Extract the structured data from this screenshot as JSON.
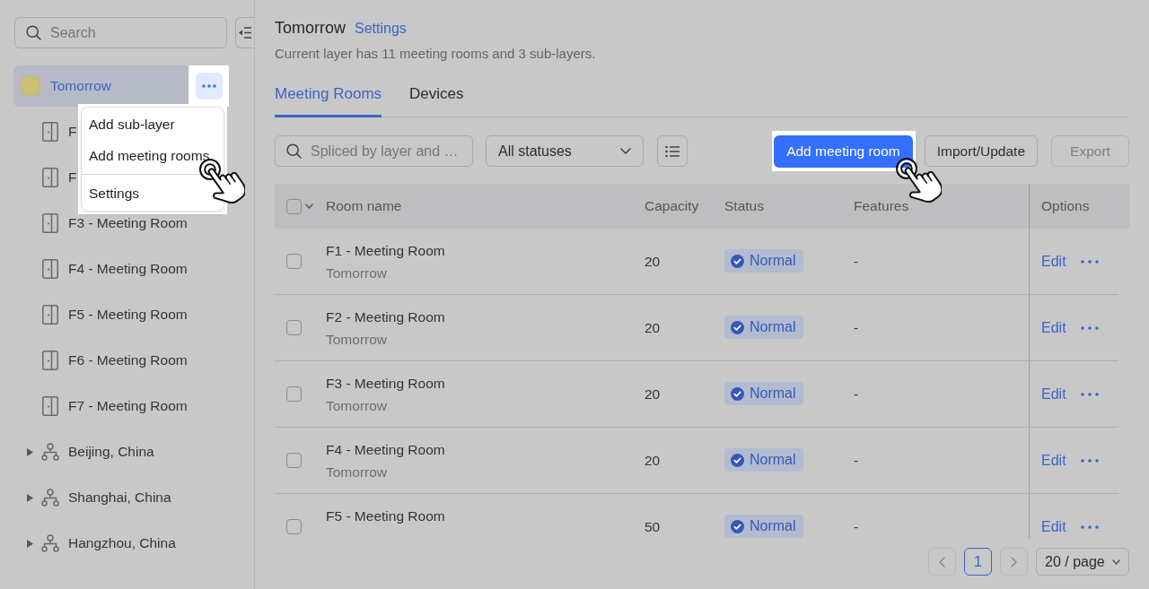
{
  "sidebar": {
    "search": {
      "placeholder": "Search"
    },
    "tree": [
      {
        "kind": "root",
        "label": "Tomorrow",
        "selected": true,
        "more_button": {
          "spotlight": true
        },
        "children": [
          {
            "kind": "room",
            "label": "F",
            "selected": false
          },
          {
            "kind": "room",
            "label": "F",
            "selected": false
          },
          {
            "kind": "room",
            "label": "F3 - Meeting Room",
            "selected": false
          },
          {
            "kind": "room",
            "label": "F4 - Meeting Room",
            "selected": false
          },
          {
            "kind": "room",
            "label": "F5 - Meeting Room",
            "selected": false
          },
          {
            "kind": "room",
            "label": "F6 - Meeting Room",
            "selected": false
          },
          {
            "kind": "room",
            "label": "F7 - Meeting Room",
            "selected": false
          }
        ]
      },
      {
        "kind": "layer",
        "label": "Beijing, China",
        "selected": false,
        "expanded": false
      },
      {
        "kind": "layer",
        "label": "Shanghai, China",
        "selected": false,
        "expanded": false
      },
      {
        "kind": "layer",
        "label": "Hangzhou, China",
        "selected": false,
        "expanded": false
      }
    ]
  },
  "context_menu": {
    "spotlight": true,
    "sections": [
      [
        {
          "label": "Add sub-layer",
          "cursor": false
        },
        {
          "label": "Add meeting rooms",
          "cursor": true
        }
      ],
      [
        {
          "label": "Settings",
          "cursor": false
        }
      ]
    ]
  },
  "header": {
    "title": "Tomorrow",
    "settings_link": "Settings",
    "summary": "Current layer has 11 meeting rooms and 3 sub-layers."
  },
  "tabs": [
    {
      "label": "Meeting Rooms",
      "selected": true
    },
    {
      "label": "Devices",
      "selected": false
    }
  ],
  "toolbar": {
    "search": {
      "placeholder": "Spliced by layer and …"
    },
    "status_filter": {
      "value": "All statuses"
    },
    "buttons": [
      {
        "kind": "primary",
        "label": "Add meeting room",
        "spotlight": true,
        "cursor": true,
        "disabled": false
      },
      {
        "kind": "secondary",
        "label": "Import/Update",
        "spotlight": false,
        "cursor": false,
        "disabled": false
      },
      {
        "kind": "secondary",
        "label": "Export",
        "spotlight": false,
        "cursor": false,
        "disabled": true
      }
    ]
  },
  "table": {
    "select_all": {
      "checked": false
    },
    "columns": [
      "Room name",
      "Capacity",
      "Status",
      "Features",
      "Options"
    ],
    "rows": [
      {
        "checked": false,
        "name": "F1 - Meeting Room",
        "layer": "Tomorrow",
        "capacity": "20",
        "status": "Normal",
        "features": "-",
        "action": "Edit"
      },
      {
        "checked": false,
        "name": "F2 - Meeting Room",
        "layer": "Tomorrow",
        "capacity": "20",
        "status": "Normal",
        "features": "-",
        "action": "Edit"
      },
      {
        "checked": false,
        "name": "F3 - Meeting Room",
        "layer": "Tomorrow",
        "capacity": "20",
        "status": "Normal",
        "features": "-",
        "action": "Edit"
      },
      {
        "checked": false,
        "name": "F4 - Meeting Room",
        "layer": "Tomorrow",
        "capacity": "20",
        "status": "Normal",
        "features": "-",
        "action": "Edit"
      },
      {
        "checked": false,
        "name": "F5 - Meeting Room",
        "capacity": "50",
        "status": "Normal",
        "features": "-",
        "action": "Edit"
      }
    ]
  },
  "pagination": {
    "prev_disabled": true,
    "next_disabled": true,
    "pages": [
      {
        "label": "1",
        "selected": true
      }
    ],
    "page_size": "20 / page"
  }
}
